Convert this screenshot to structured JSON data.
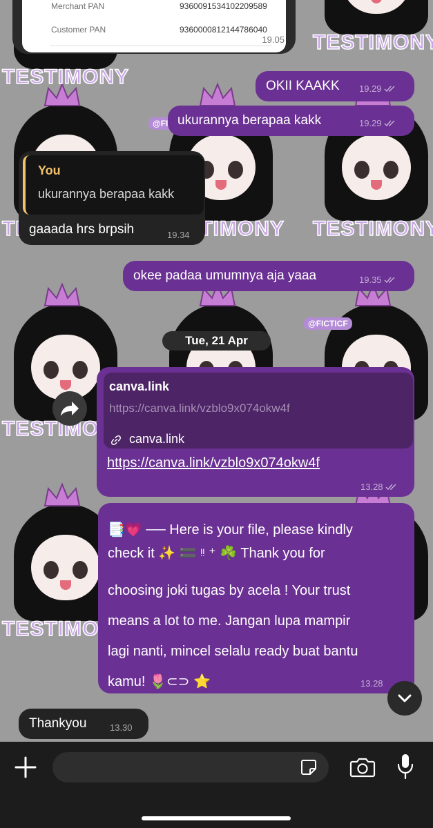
{
  "wallpaper": {
    "watermark": "TESTIMONY",
    "tag": "@FICTICF"
  },
  "receipt": {
    "rows": [
      {
        "label": "Merchant PAN",
        "value": "9360091534102209589"
      },
      {
        "label": "Customer PAN",
        "value": "9360000812144786040"
      }
    ],
    "time": "19.05"
  },
  "messages": [
    {
      "text": "OKII KAAKK",
      "time": "19.29"
    },
    {
      "text": "ukurannya berapaa kakk",
      "time": "19.29"
    },
    {
      "reply_author": "You",
      "reply_text": "ukurannya berapaa kakk",
      "text": "gaaada hrs brpsih",
      "time": "19.34"
    },
    {
      "text": "okee padaa umumnya aja yaaa",
      "time": "19.35"
    }
  ],
  "date_separator": "Tue, 21 Apr",
  "link_message": {
    "site": "canva.link",
    "preview_url": "https://canva.link/vzblo9x074okw4f",
    "preview_domain": "canva.link",
    "url": "https://canva.link/vzblo9x074okw4f",
    "time": "13.28"
  },
  "long_message": {
    "line1": "📑💗 ── Here is your file, please kindly",
    "line2": "check it ✨ 🟰 ᵎᵎ ⁺ ☘️ Thank you for",
    "line3": "choosing joki tugas by acela ! Your trust",
    "line4": "means a lot to me. Jangan lupa mampir",
    "line5": "lagi nanti, mincel selalu ready buat bantu",
    "line6": "kamu! 🌷⊂⊃ ⭐",
    "time": "13.28"
  },
  "last_message": {
    "text": "Thankyou",
    "time": "13.30"
  },
  "icons": [
    "plus-icon",
    "sticker-icon",
    "camera-icon",
    "microphone-icon",
    "chevron-down-icon",
    "forward-icon",
    "link-icon",
    "double-check-icon"
  ]
}
